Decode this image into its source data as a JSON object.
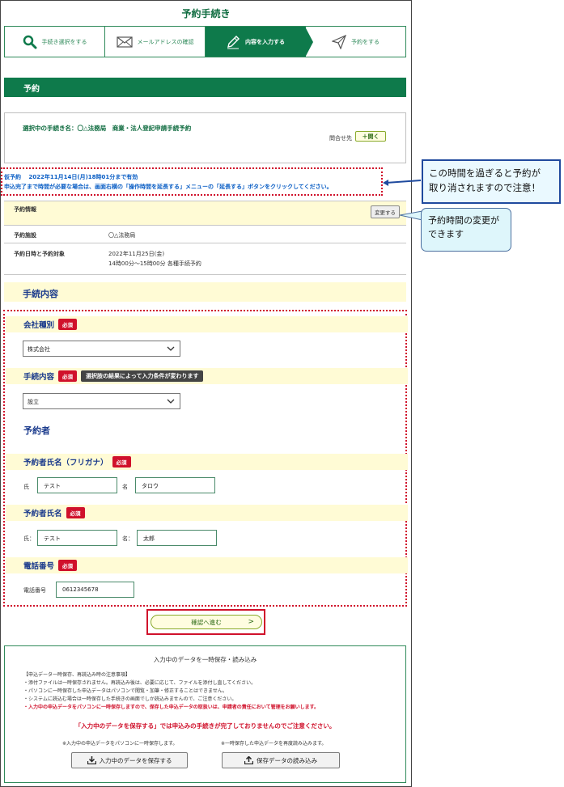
{
  "page_title": "予約手続き",
  "steps": [
    {
      "label": "手続き選択をする",
      "icon": "search-icon",
      "active": false
    },
    {
      "label": "メールアドレスの確認",
      "icon": "mail-icon",
      "active": false
    },
    {
      "label": "内容を入力する",
      "icon": "pencil-icon",
      "active": true
    },
    {
      "label": "予約をする",
      "icon": "send-icon",
      "active": false
    }
  ],
  "section_header": "予約",
  "selected_procedure": {
    "label": "選択中の手続き名：",
    "value": "〇△法務局　商業・法人登記申請手続予約",
    "contact_label": "問合せ先",
    "open_button": "＋開く"
  },
  "temporary": {
    "line1": "仮予約　 2022年11月14日(月)18時01分まで有効",
    "line2": "申込完了まで時間が必要な場合は、画面右横の「操作時間を延長する」メニューの「延長する」ボタンをクリックしてください。"
  },
  "reservation": {
    "info_label": "予約情報",
    "change_button": "変更する",
    "facility_label": "予約施設",
    "facility_value": "〇△法務局",
    "datetime_label": "予約日時と予約対象",
    "date_value": "2022年11月25日(金)",
    "time_value": "14時00分～15時00分 各種手続予約"
  },
  "procedure_section": "手続内容",
  "form": {
    "company_type_label": "会社種別",
    "company_type_value": "株式会社",
    "procedure_label": "手続内容",
    "procedure_note": "選択肢の結果によって入力条件が変わります",
    "procedure_value": "設立",
    "required_badge": "必須",
    "booker_heading": "予約者",
    "kana_label": "予約者氏名（フリガナ）",
    "kana_surname_label": "氏",
    "kana_surname_value": "テスト",
    "kana_given_label": "名",
    "kana_given_value": "タロウ",
    "name_label": "予約者氏名",
    "name_surname_label": "氏：",
    "name_surname_value": "テスト",
    "name_given_label": "名：",
    "name_given_value": "太郎",
    "phone_label": "電話番号",
    "phone_field_label": "電話番号",
    "phone_value": "0612345678"
  },
  "confirm_button": "確認へ進む",
  "confirm_chevron": ">",
  "save_section": {
    "title": "入力中のデータを一時保存・読み込み",
    "notes_heading": "【申込データ一時保存、再読込み時の注意事項】",
    "notes": [
      "・添付ファイルは一時保存されません。再読込み後は、必要に応じて、ファイルを添付し直してください。",
      "・パソコンに一時保存した申込データはパソコンで閲覧・加筆・修正することはできません。",
      "・システムに読込む場合は一時保存した手続きの画面でしか読込みませんので、ご注意ください。"
    ],
    "note_red": "・入力中の申込データをパソコンに一時保存しますので、保存した申込データの取扱いは、申請者の責任において管理をお願いします。",
    "warning": "「入力中のデータを保存する」では申込みの手続きが完了しておりませんのでご注意ください。",
    "save_caption": "※入力中の申込データをパソコンに一時保存します。",
    "load_caption": "※一時保存した申込データを再度読み込みます。",
    "save_button": "入力中のデータを保存する",
    "load_button": "保存データの読み込み"
  },
  "callouts": {
    "expiry_line1": "この時間を過ぎると予約が",
    "expiry_line2": "取り消されますので注意！",
    "change_line1": "予約時間の変更が",
    "change_line2": "できます"
  },
  "colors": {
    "brand_green": "#0e7a4b",
    "required_red": "#d0112b",
    "notice_blue": "#0a5ec5",
    "label_navy": "#1a3a8c",
    "section_yellow": "#fffbd5"
  }
}
